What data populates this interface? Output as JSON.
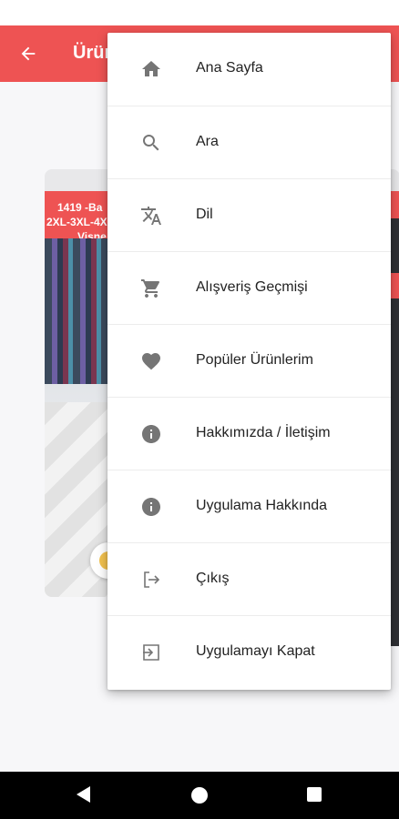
{
  "app_bar": {
    "title": "Ürünler",
    "back_icon": "arrow-left-icon",
    "color": "#ee5353"
  },
  "product_card": {
    "banner_lines": [
      "1419 -Ba",
      "2XL-3XL-4X",
      "Vişne"
    ],
    "favorite_icon": "heart-icon"
  },
  "menu": {
    "items": [
      {
        "label": "Ana Sayfa",
        "icon": "home-icon"
      },
      {
        "label": "Ara",
        "icon": "search-icon"
      },
      {
        "label": "Dil",
        "icon": "translate-icon"
      },
      {
        "label": "Alışveriş Geçmişi",
        "icon": "cart-icon"
      },
      {
        "label": "Popüler Ürünlerim",
        "icon": "heart-icon"
      },
      {
        "label": "Hakkımızda / İletişim",
        "icon": "info-icon"
      },
      {
        "label": "Uygulama Hakkında",
        "icon": "info-icon"
      },
      {
        "label": "Çıkış",
        "icon": "logout-icon"
      },
      {
        "label": "Uygulamayı Kapat",
        "icon": "close-app-icon"
      }
    ]
  },
  "nav_bar": {
    "back_icon": "nav-back-icon",
    "home_icon": "nav-home-icon",
    "recents_icon": "nav-recents-icon"
  },
  "colors": {
    "accent": "#ee5353",
    "icon": "#757575",
    "text": "#222222"
  }
}
